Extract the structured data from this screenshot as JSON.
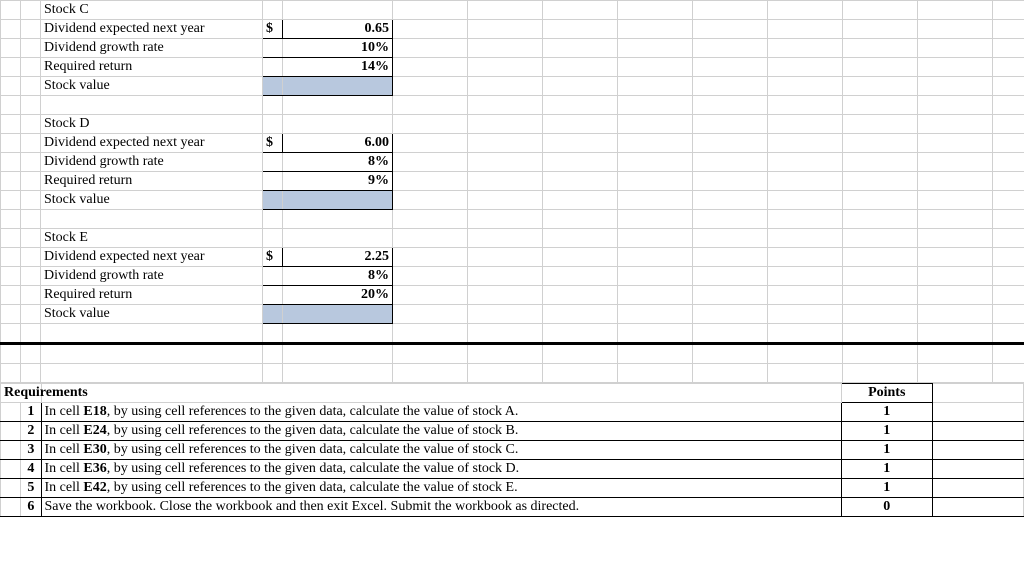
{
  "stocks": {
    "c": {
      "title": "Stock C",
      "div_label": "Dividend expected next year",
      "div_cur": "$",
      "div_val": "0.65",
      "growth_label": "Dividend growth rate",
      "growth_val": "10%",
      "req_label": "Required return",
      "req_val": "14%",
      "val_label": "Stock value"
    },
    "d": {
      "title": "Stock D",
      "div_label": "Dividend expected next year",
      "div_cur": "$",
      "div_val": "6.00",
      "growth_label": "Dividend growth rate",
      "growth_val": "8%",
      "req_label": "Required return",
      "req_val": "9%",
      "val_label": "Stock value"
    },
    "e": {
      "title": "Stock E",
      "div_label": "Dividend expected next year",
      "div_cur": "$",
      "div_val": "2.25",
      "growth_label": "Dividend growth rate",
      "growth_val": "8%",
      "req_label": "Required return",
      "req_val": "20%",
      "val_label": "Stock value"
    }
  },
  "requirements": {
    "heading": "Requirements",
    "points_heading": "Points",
    "items": [
      {
        "n": "1",
        "text": "In cell E18, by using cell references to the given data, calculate the value of stock A.",
        "pts": "1"
      },
      {
        "n": "2",
        "text": "In cell E24, by using cell references to the given data, calculate the value of stock B.",
        "pts": "1"
      },
      {
        "n": "3",
        "text": "In cell E30, by using cell references to the given data, calculate the value of stock C.",
        "pts": "1"
      },
      {
        "n": "4",
        "text": "In cell E36, by using cell references to the given data, calculate the value of stock D.",
        "pts": "1"
      },
      {
        "n": "5",
        "text": "In cell E42, by using cell references to the given data, calculate the value of stock E.",
        "pts": "1"
      },
      {
        "n": "6",
        "text": "Save the workbook. Close the workbook and then exit Excel. Submit the workbook as directed.",
        "pts": "0"
      }
    ]
  },
  "chart_data": {
    "type": "table",
    "title": "Gordon growth model inputs for stocks C, D, E and point-valued requirements list",
    "stocks": [
      {
        "name": "Stock C",
        "dividend_next_year": 0.65,
        "growth_rate": 0.1,
        "required_return": 0.14
      },
      {
        "name": "Stock D",
        "dividend_next_year": 6.0,
        "growth_rate": 0.08,
        "required_return": 0.09
      },
      {
        "name": "Stock E",
        "dividend_next_year": 2.25,
        "growth_rate": 0.08,
        "required_return": 0.2
      }
    ],
    "requirements_points": [
      1,
      1,
      1,
      1,
      1,
      0
    ]
  }
}
